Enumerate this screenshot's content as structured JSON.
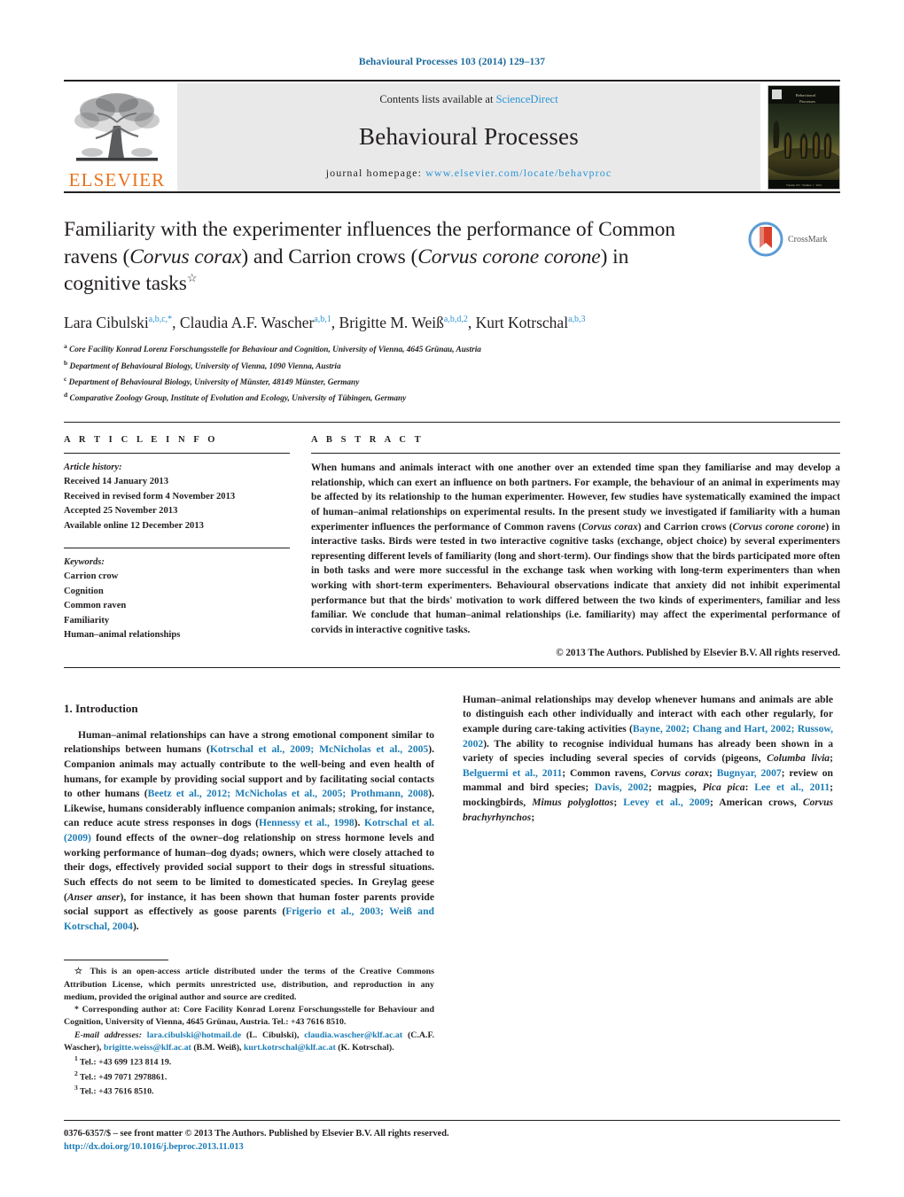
{
  "running_head": "Behavioural Processes 103 (2014) 129–137",
  "masthead": {
    "contents_prefix": "Contents lists available at ",
    "sciencedirect": "ScienceDirect",
    "journal_title": "Behavioural Processes",
    "homepage_label": "journal homepage:",
    "homepage_url": "www.elsevier.com/locate/behavproc",
    "publisher": "ELSEVIER",
    "cover_caption": "Behavioural Processes"
  },
  "title": {
    "line1": "Familiarity with the experimenter influences the performance of",
    "line2_a": "Common ravens (",
    "line2_i": "Corvus corax",
    "line2_b": ") and Carrion crows (",
    "line2_i2": "Corvus corone",
    "line3_i": "corone",
    "line3_b": ") in cognitive tasks",
    "dagger": "☆"
  },
  "crossmark": {
    "label": "CrossMark"
  },
  "authors": [
    {
      "name": "Lara Cibulski",
      "sup": "a,b,c,*"
    },
    {
      "name": "Claudia A.F. Wascher",
      "sup": "a,b,1"
    },
    {
      "name": "Brigitte M. Weiß",
      "sup": "a,b,d,2"
    },
    {
      "name": "Kurt Kotrschal",
      "sup": "a,b,3"
    }
  ],
  "affiliations": [
    {
      "mark": "a",
      "text": "Core Facility Konrad Lorenz Forschungsstelle for Behaviour and Cognition, University of Vienna, 4645 Grünau, Austria"
    },
    {
      "mark": "b",
      "text": "Department of Behavioural Biology, University of Vienna, 1090 Vienna, Austria"
    },
    {
      "mark": "c",
      "text": "Department of Behavioural Biology, University of Münster, 48149 Münster, Germany"
    },
    {
      "mark": "d",
      "text": "Comparative Zoology Group, Institute of Evolution and Ecology, University of Tübingen, Germany"
    }
  ],
  "article_info": {
    "heading": "A R T I C L E   I N F O",
    "history_label": "Article history:",
    "history": [
      "Received 14 January 2013",
      "Received in revised form 4 November 2013",
      "Accepted 25 November 2013",
      "Available online 12 December 2013"
    ],
    "keywords_label": "Keywords:",
    "keywords": [
      "Carrion crow",
      "Cognition",
      "Common raven",
      "Familiarity",
      "Human–animal relationships"
    ]
  },
  "abstract": {
    "heading": "A B S T R A C T",
    "part1": "When humans and animals interact with one another over an extended time span they familiarise and may develop a relationship, which can exert an influence on both partners. For example, the behaviour of an animal in experiments may be affected by its relationship to the human experimenter. However, few studies have systematically examined the impact of human–animal relationships on experimental results. In the present study we investigated if familiarity with a human experimenter influences the performance of Common ravens (",
    "sp1": "Corvus corax",
    "part2": ") and Carrion crows (",
    "sp2": "Corvus corone corone",
    "part3": ") in interactive tasks. Birds were tested in two interactive cognitive tasks (exchange, object choice) by several experimenters representing different levels of familiarity (long and short-term). Our findings show that the birds participated more often in both tasks and were more successful in the exchange task when working with long-term experimenters than when working with short-term experimenters. Behavioural observations indicate that anxiety did not inhibit experimental performance but that the birds' motivation to work differed between the two kinds of experimenters, familiar and less familiar. We conclude that human–animal relationships (i.e. familiarity) may affect the experimental performance of corvids in interactive cognitive tasks.",
    "copyright": "© 2013 The Authors. Published by Elsevier B.V. All rights reserved."
  },
  "introduction": {
    "heading": "1.  Introduction",
    "p1_a": "Human–animal relationships can have a strong emotional component similar to relationships between humans (",
    "p1_ref1": "Kotrschal et al., 2009; McNicholas et al., 2005",
    "p1_b": "). Companion animals may actually contribute to the well-being and even health of humans, for example by providing social support and by facilitating social contacts to other humans (",
    "p1_ref2": "Beetz et al., 2012; McNicholas et al., 2005; Prothmann, 2008",
    "p1_c": "). Likewise, humans considerably influence companion animals; stroking, for instance, can reduce acute stress responses in dogs (",
    "p1_ref3": "Hennessy et al., 1998",
    "p1_d": "). ",
    "p1_ref4": "Kotrschal et al. (2009)",
    "p1_e": " found effects of the owner–dog relationship on stress hormone levels and working performance of human–dog dyads; owners, which were closely attached to their dogs, effectively provided social support to their dogs in stressful situations. Such effects do not seem to be limited to domesticated species. In Greylag geese (",
    "p1_sp": "Anser anser",
    "p1_f": "), for instance, it has been shown that human foster parents provide social support as effectively as goose parents (",
    "p1_ref5": "Frigerio et al., 2003; Weiß and Kotrschal, 2004",
    "p1_g": ").",
    "p2_a": "Human–animal relationships may develop whenever humans and animals are able to distinguish each other individually and interact with each other regularly, for example during care-taking activities (",
    "p2_ref1": "Bayne, 2002; Chang and Hart, 2002; Russow, 2002",
    "p2_b": "). The ability to recognise individual humans has already been shown in a variety of species including several species of corvids (pigeons, ",
    "p2_sp1": "Columba livia",
    "p2_c": "; ",
    "p2_ref2": "Belguermi et al., 2011",
    "p2_d": "; Common ravens, ",
    "p2_sp2": "Corvus corax",
    "p2_e": "; ",
    "p2_ref3": "Bugnyar, 2007",
    "p2_f": "; review on mammal and bird species; ",
    "p2_ref4": "Davis, 2002",
    "p2_g": "; magpies, ",
    "p2_sp3": "Pica pica",
    "p2_h": ": ",
    "p2_ref5": "Lee et al., 2011",
    "p2_i": "; mockingbirds, ",
    "p2_sp4": "Mimus polyglottos",
    "p2_j": "; ",
    "p2_ref6": "Levey et al., 2009",
    "p2_k": "; American crows, ",
    "p2_sp5": "Corvus brachyrhynchos",
    "p2_l": ";"
  },
  "footnotes": {
    "open_access": "☆  This is an open-access article distributed under the terms of the Creative Commons Attribution License, which permits unrestricted use, distribution, and reproduction in any medium, provided the original author and source are credited.",
    "corresponding": "*  Corresponding author at: Core Facility Konrad Lorenz Forschungsstelle for Behaviour and Cognition, University of Vienna, 4645 Grünau, Austria. Tel.: +43 7616 8510.",
    "email_label": "E-mail addresses:",
    "emails": [
      {
        "addr": "lara.cibulski@hotmail.de",
        "who": "(L. Cibulski)"
      },
      {
        "addr": "claudia.wascher@klf.ac.at",
        "who": "(C.A.F. Wascher)"
      },
      {
        "addr": "brigitte.weiss@klf.ac.at",
        "who": "(B.M. Weiß)"
      },
      {
        "addr": "kurt.kotrschal@klf.ac.at",
        "who": "(K. Kotrschal)"
      }
    ],
    "tels": [
      {
        "mark": "1",
        "text": "Tel.: +43 699 123 814 19."
      },
      {
        "mark": "2",
        "text": "Tel.: +49 7071 2978861."
      },
      {
        "mark": "3",
        "text": "Tel.: +43 7616 8510."
      }
    ]
  },
  "bottom": {
    "issn_line": "0376-6357/$ – see front matter © 2013 The Authors. Published by Elsevier B.V. All rights reserved.",
    "doi": "http://dx.doi.org/10.1016/j.beproc.2013.11.013"
  },
  "colors": {
    "link": "#1b7cb5",
    "sciencedirect": "#2a94d6",
    "elsevier_orange": "#E9711C",
    "band": "#e9e9e9"
  }
}
